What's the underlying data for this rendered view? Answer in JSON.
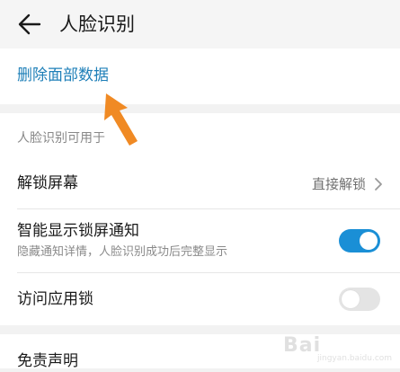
{
  "header": {
    "title": "人脸识别",
    "back_icon": "arrow-left-icon"
  },
  "delete_section": {
    "label": "删除面部数据",
    "color": "#1e7fb8"
  },
  "usage_section": {
    "label": "人脸识别可用于",
    "rows": [
      {
        "title": "解锁屏幕",
        "value": "直接解锁",
        "icon": "chevron-right-icon"
      },
      {
        "title": "智能显示锁屏通知",
        "subtitle": "隐藏通知详情，人脸识别成功后完整显示",
        "toggle": true
      },
      {
        "title": "访问应用锁",
        "toggle": false
      }
    ]
  },
  "disclaimer": {
    "title": "免责声明"
  },
  "colors": {
    "accent": "#1a8fd6",
    "annotation_arrow": "#f08a24"
  },
  "watermark": {
    "logo": "Bai",
    "sub": "jingyan.baidu.com"
  }
}
